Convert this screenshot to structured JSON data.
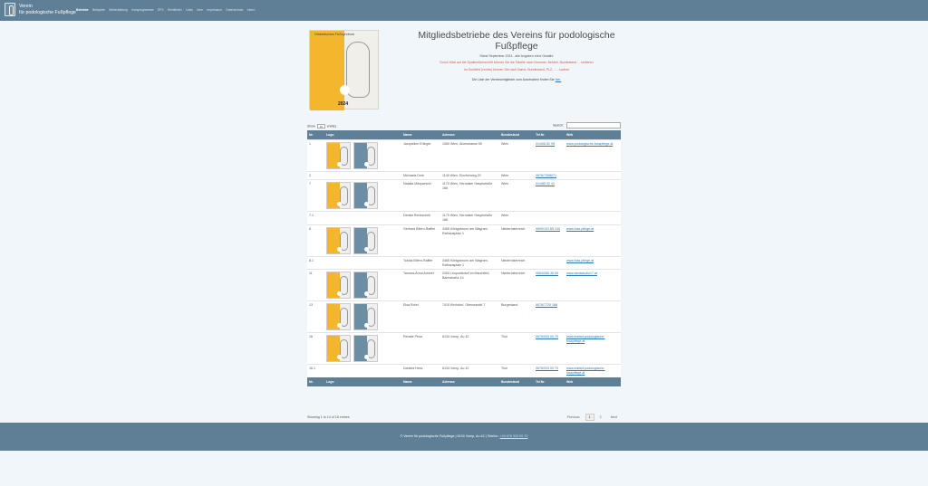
{
  "brand": {
    "line1": "Verein",
    "line2": "für podologische Fußpflege"
  },
  "nav": [
    "Betriebe",
    "Beispiele",
    "Weiterbildung",
    "Kursprogramme",
    "EFS",
    "Richtlinien",
    "Links",
    "Idee",
    "Impressum",
    "Datenschutz",
    "Intern"
  ],
  "hero": {
    "image_caption": "Diabetisches Fußsyndrom",
    "image_year": "2024",
    "title": "Mitgliedsbetriebe des Vereins für podologische Fußpflege",
    "subtitle": "Stand September 2024 - alle Angaben ohne Gewähr",
    "note1": "Durch Klick auf die Spaltenüberschrift können Sie die Tabelle nach Nummer, Betrieb, Bundesland ... sortieren",
    "note2": "Im Suchfeld (rechts) können Sie nach Name, Bundesland, PLZ, ..... suchen",
    "info_prefix": "Die Liste der Vereinsmitglieder zum Ausdrucken finden Sie",
    "info_link": "hier."
  },
  "controls": {
    "show_prefix": "Show",
    "show_value": "10",
    "show_suffix": "entries",
    "search_label": "Search:"
  },
  "columns": [
    "Nr.",
    "Logo",
    "Name",
    "Adresse",
    "Bundesland",
    "Tel.Nr.",
    "Web"
  ],
  "rows": [
    {
      "nr": "1",
      "logo": true,
      "name": "Jacqueline Erlinger",
      "addr": "1080 Wien, Alserstrasse 55",
      "bl": "Wien",
      "tel": "01/408 82 95",
      "web": "www.podologische-fusspflege.at"
    },
    {
      "nr": "2",
      "logo": false,
      "name": "Michaela Derk",
      "addr": "1140 Wien, Einzherweg 20",
      "bl": "Wien",
      "tel": "0676/7308071",
      "web": ""
    },
    {
      "nr": "7",
      "logo": true,
      "name": "Natalia Mikrywnicki",
      "addr": "1170 Wien, Hernalser Hauptstraße 166",
      "bl": "Wien",
      "tel": "01/485 02 41",
      "web": ""
    },
    {
      "nr": "7.1",
      "logo": false,
      "name": "Denise Beneschek",
      "addr": "1170 Wien, Hernalser Hauptstraße 166",
      "bl": "Wien",
      "tel": "",
      "web": ""
    },
    {
      "nr": "8",
      "logo": true,
      "name": "Gerhard Bifern-Raffler",
      "addr": "3465 Königsbrunn am Wagram, Rathausplatz 1",
      "bl": "Niederösterreich",
      "tel": "0699/101 85 130",
      "web": "www.fuss-pflege.at"
    },
    {
      "nr": "8.1",
      "logo": false,
      "name": "Tobias Bifern-Raffler",
      "addr": "3465 Königsbrunn am Wagram, Rathausplatz 1",
      "bl": "Niederösterreich",
      "tel": "",
      "web": "www.fuss-pflege.at"
    },
    {
      "nr": "11",
      "logo": true,
      "name": "Tamara-Anna Ammer",
      "addr": "2263 Leopoldsdorf im Marchfeld, Bahnstraße 14",
      "bl": "Niederösterreich",
      "tel": "0664/266 36 69",
      "web": "www.tamsstudio17.at"
    },
    {
      "nr": "13",
      "logo": true,
      "name": "Elsa Rohrl",
      "addr": "7410 Kirchdorf, Obenwindel 7",
      "bl": "Burgenland",
      "tel": "0676/7720 188",
      "web": ""
    },
    {
      "nr": "16",
      "logo": true,
      "name": "Renate Pesa",
      "addr": "6134 Vomp, Au 42",
      "bl": "Tirol",
      "tel": "0676/933 00 70",
      "web": "www.institut-podologische-fusspflege.at"
    },
    {
      "nr": "16.1",
      "logo": false,
      "name": "Daniela Hesz",
      "addr": "6134 Vomp, Au 42",
      "bl": "Tirol",
      "tel": "0676/933 00 70",
      "web": "www.institut-podologische-fusspflege.at"
    }
  ],
  "pager": {
    "info": "Showing 1 to 10 of 18 entries",
    "prev": "Previous",
    "p1": "1",
    "p2": "2",
    "next": "Next"
  },
  "footer": {
    "text": "© Verein für podologische Fußpflege | 6134 Vomp, Au 42 | Telefon:",
    "link": "+43 676 933 00 70"
  }
}
